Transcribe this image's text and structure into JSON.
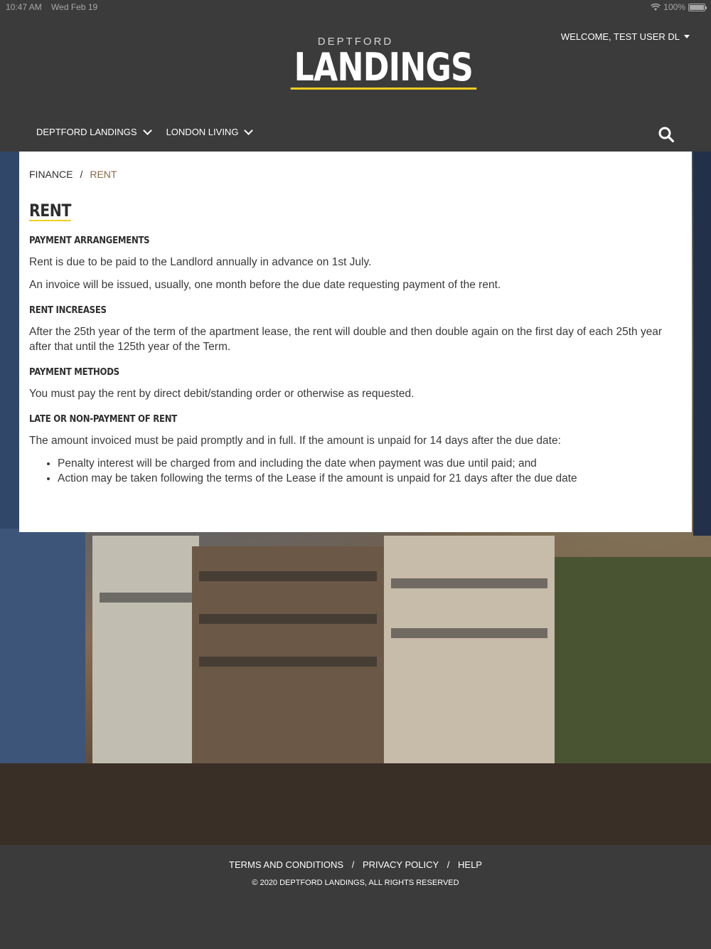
{
  "status_bar": {
    "time": "10:47 AM",
    "date": "Wed Feb 19",
    "battery": "100%",
    "battery_level": 1.0
  },
  "header": {
    "logo_small": "DEPTFORD",
    "logo_big": "LANDINGS",
    "user_menu": "WELCOME, TEST USER DL",
    "accent_color": "#f1cc1f"
  },
  "nav": {
    "items": [
      {
        "label": "DEPTFORD LANDINGS"
      },
      {
        "label": "LONDON LIVING"
      }
    ]
  },
  "breadcrumb": {
    "parent": "FINANCE",
    "separator": "/",
    "current": "RENT"
  },
  "content": {
    "title": "RENT",
    "sections": [
      {
        "heading": "PAYMENT ARRANGEMENTS",
        "paragraphs": [
          "Rent is due to be paid to the Landlord annually in advance on 1st July.",
          "An invoice will be issued, usually, one month before the due date requesting payment of the rent."
        ]
      },
      {
        "heading": "RENT INCREASES",
        "paragraphs": [
          "After the 25th year of the term of the apartment lease, the rent will double and then double again on the first day of each 25th year after that until the 125th year of the Term."
        ]
      },
      {
        "heading": "PAYMENT METHODS",
        "paragraphs": [
          "You must pay the rent by direct debit/standing order or otherwise as requested."
        ]
      },
      {
        "heading": "LATE OR NON-PAYMENT OF RENT",
        "paragraphs": [
          "The amount invoiced must be paid promptly and in full. If the amount is unpaid for 14 days after the due date:"
        ],
        "bullets": [
          "Penalty interest will be charged from and including the date when payment was due until paid; and",
          "Action may be taken following the terms of the Lease if the amount is unpaid for 21 days after the due date"
        ]
      }
    ]
  },
  "footer": {
    "links": [
      "TERMS AND CONDITIONS",
      "PRIVACY POLICY",
      "HELP"
    ],
    "separator": "/",
    "copyright": "© 2020 DEPTFORD LANDINGS, ALL RIGHTS RESERVED"
  }
}
